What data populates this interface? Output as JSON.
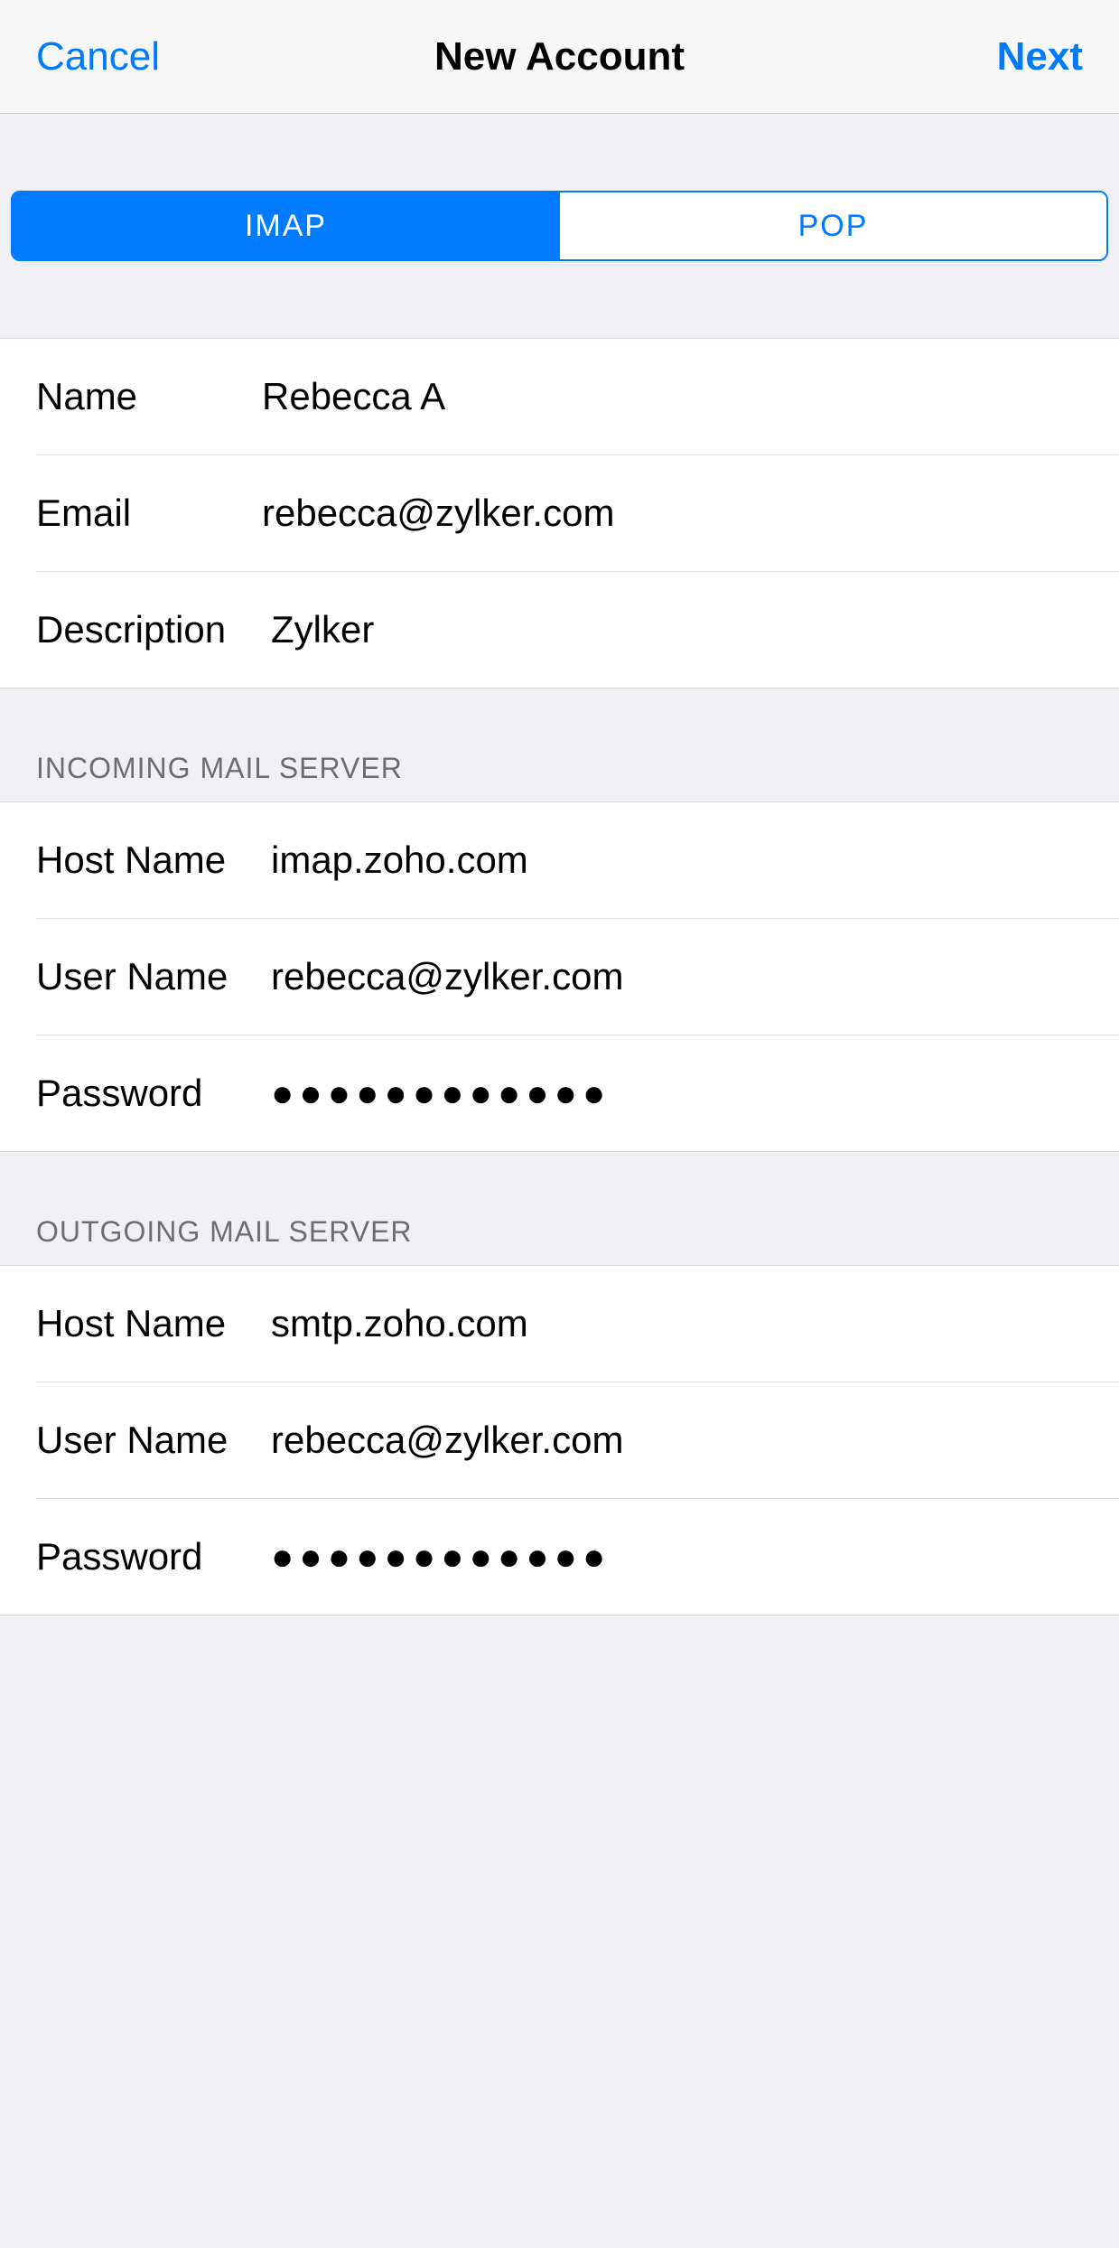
{
  "navbar": {
    "cancel": "Cancel",
    "title": "New Account",
    "next": "Next"
  },
  "segmented": {
    "imap": "IMAP",
    "pop": "POP",
    "active": "imap"
  },
  "account": {
    "name_label": "Name",
    "name_value": "Rebecca A",
    "email_label": "Email",
    "email_value": "rebecca@zylker.com",
    "description_label": "Description",
    "description_value": "Zylker"
  },
  "incoming": {
    "header": "INCOMING MAIL SERVER",
    "host_label": "Host Name",
    "host_value": "imap.zoho.com",
    "user_label": "User Name",
    "user_value": "rebecca@zylker.com",
    "password_label": "Password",
    "password_value": "●●●●●●●●●●●●"
  },
  "outgoing": {
    "header": "OUTGOING MAIL SERVER",
    "host_label": "Host Name",
    "host_value": "smtp.zoho.com",
    "user_label": "User Name",
    "user_value": "rebecca@zylker.com",
    "password_label": "Password",
    "password_value": "●●●●●●●●●●●●"
  }
}
